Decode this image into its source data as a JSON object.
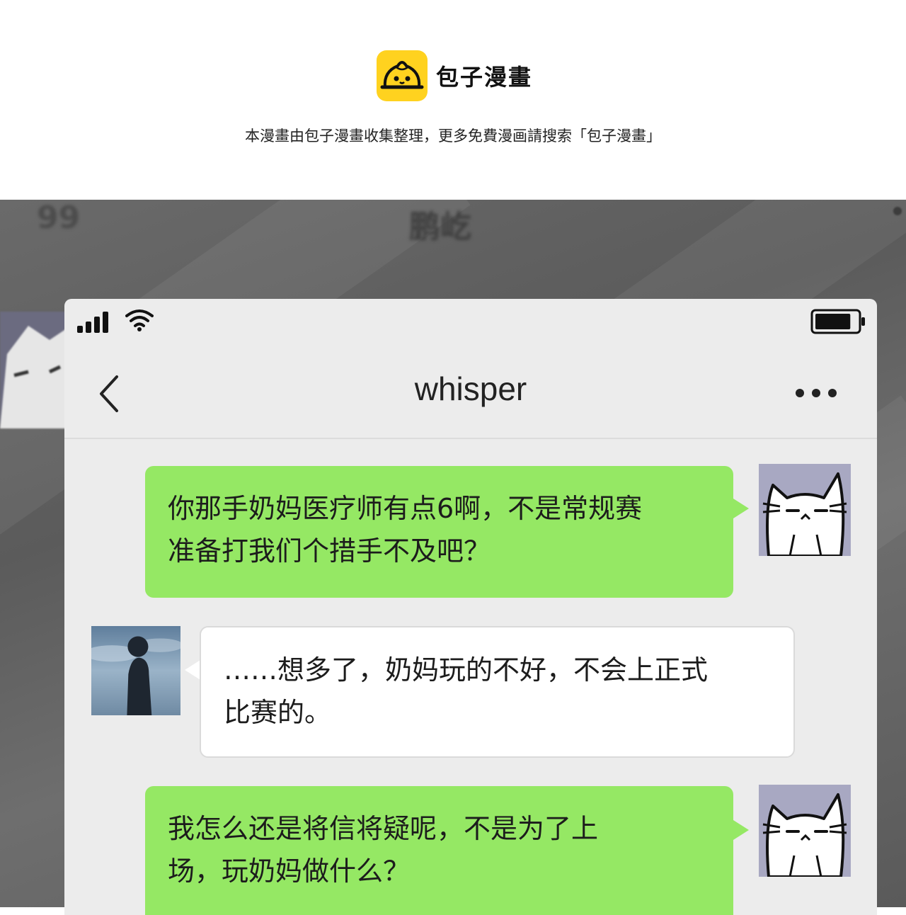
{
  "banner": {
    "logo_text": "包子漫畫",
    "logo_icon": "bun-mascot-icon",
    "brand_color": "#ffd21f",
    "notice": "本漫畫由包子漫畫收集整理，更多免費漫画請搜索「包子漫畫」"
  },
  "background": {
    "blurred_number": "99",
    "blurred_title": "鹏屹"
  },
  "phone": {
    "status": {
      "signal_icon": "signal-bars-icon",
      "wifi_icon": "wifi-icon",
      "battery_icon": "battery-icon",
      "battery_level": 0.85
    },
    "header": {
      "back_icon": "chevron-left-icon",
      "title": "whisper",
      "more_icon": "more-dots-icon"
    },
    "messages": [
      {
        "side": "right",
        "color": "#95e864",
        "avatar_icon": "cat-avatar-icon",
        "lines": [
          "你那手奶妈医疗师有点6啊，不是常规赛",
          "准备打我们个措手不及吧？"
        ]
      },
      {
        "side": "left",
        "color": "#ffffff",
        "avatar_icon": "silhouette-avatar-icon",
        "lines": [
          "……想多了，奶妈玩的不好，不会上正式",
          "比赛的。"
        ]
      },
      {
        "side": "right",
        "color": "#95e864",
        "avatar_icon": "cat-avatar-icon",
        "lines": [
          "我怎么还是将信将疑呢，不是为了上",
          "场，玩奶妈做什么？"
        ]
      }
    ]
  }
}
